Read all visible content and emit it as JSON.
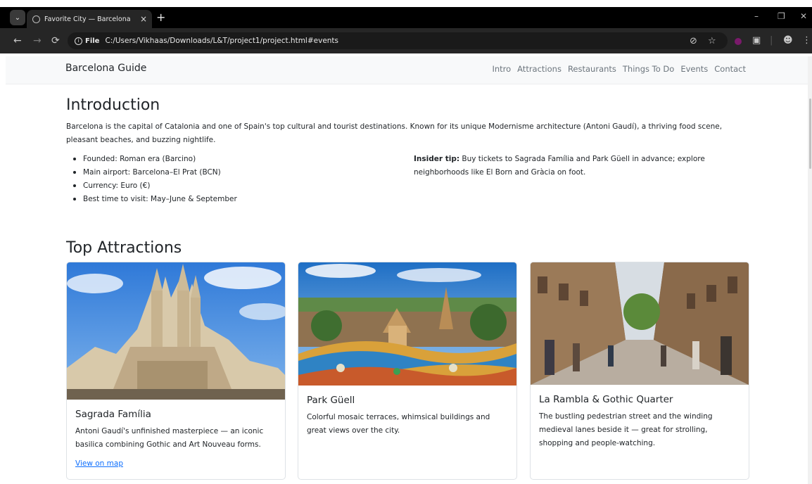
{
  "browser": {
    "tab_title": "Favorite City — Barcelona",
    "tab_close": "×",
    "new_tab": "+",
    "url_scheme": "File",
    "url": "C:/Users/Vikhaas/Downloads/L&T/project1/project.html#events",
    "icons": [
      "tab-menu-icon",
      "globe-icon",
      "back-icon",
      "forward-icon",
      "reload-icon",
      "info-icon",
      "eye-off-icon",
      "star-icon",
      "extension-icon",
      "puzzle-icon",
      "profile-icon",
      "kebab-icon",
      "minimize-icon",
      "restore-icon",
      "close-icon"
    ]
  },
  "site": {
    "brand": "Barcelona Guide",
    "nav": [
      "Intro",
      "Attractions",
      "Restaurants",
      "Things To Do",
      "Events",
      "Contact"
    ]
  },
  "intro": {
    "heading": "Introduction",
    "lead": "Barcelona is the capital of Catalonia and one of Spain's top cultural and tourist destinations. Known for its unique Modernisme architecture (Antoni Gaudí), a thriving food scene, pleasant beaches, and buzzing nightlife.",
    "facts": [
      "Founded: Roman era (Barcino)",
      "Main airport: Barcelona–El Prat (BCN)",
      "Currency: Euro (€)",
      "Best time to visit: May–June & September"
    ],
    "tip_label": "Insider tip:",
    "tip_text": " Buy tickets to Sagrada Família and Park Güell in advance; explore neighborhoods like El Born and Gràcia on foot."
  },
  "attractions": {
    "heading": "Top Attractions",
    "cards": [
      {
        "title": "Sagrada Família",
        "text": "Antoni Gaudí's unfinished masterpiece — an iconic basilica combining Gothic and Art Nouveau forms.",
        "link": "View on map"
      },
      {
        "title": "Park Güell",
        "text": "Colorful mosaic terraces, whimsical buildings and great views over the city.",
        "link": ""
      },
      {
        "title": "La Rambla & Gothic Quarter",
        "text": "The bustling pedestrian street and the winding medieval lanes beside it — great for strolling, shopping and people-watching.",
        "link": ""
      }
    ]
  },
  "colors": {
    "link": "#0d6efd",
    "nav_bg": "#f8f9fa",
    "muted": "#6c757d",
    "chrome_dark": "#262626"
  }
}
